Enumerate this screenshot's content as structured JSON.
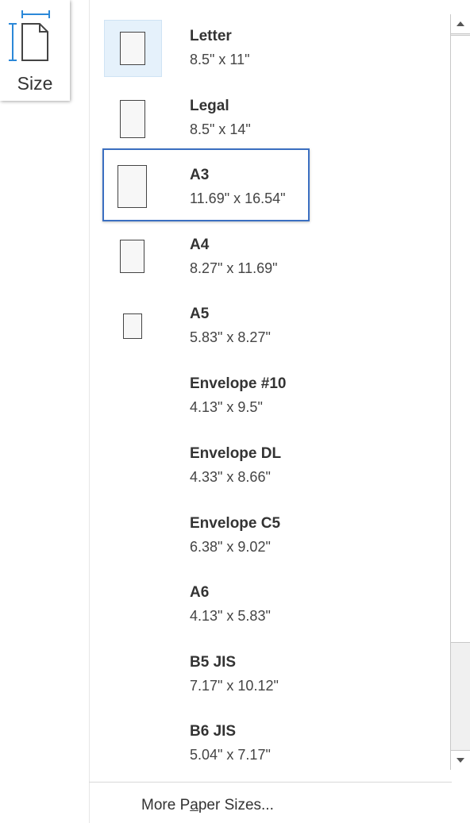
{
  "size_button": {
    "label": "Size",
    "icon": "page-size-icon"
  },
  "menu": {
    "items": [
      {
        "name": "Letter",
        "dims": "8.5\" x 11\"",
        "icon": "page-icon",
        "selected": true
      },
      {
        "name": "Legal",
        "dims": "8.5\" x 14\"",
        "icon": "page-icon"
      },
      {
        "name": "A3",
        "dims": "11.69\" x 16.54\"",
        "icon": "page-icon",
        "focused": true
      },
      {
        "name": "A4",
        "dims": "8.27\" x 11.69\"",
        "icon": "page-icon"
      },
      {
        "name": "A5",
        "dims": "5.83\" x 8.27\"",
        "icon": "page-icon"
      },
      {
        "name": "Envelope #10",
        "dims": "4.13\" x 9.5\""
      },
      {
        "name": "Envelope DL",
        "dims": "4.33\" x 8.66\""
      },
      {
        "name": "Envelope C5",
        "dims": "6.38\" x 9.02\""
      },
      {
        "name": "A6",
        "dims": "4.13\" x 5.83\""
      },
      {
        "name": "B5 JIS",
        "dims": "7.17\" x 10.12\""
      },
      {
        "name": "B6 JIS",
        "dims": "5.04\" x 7.17\""
      }
    ],
    "more_pre": "More P",
    "more_underlined": "a",
    "more_post": "per Sizes..."
  },
  "colors": {
    "selected_bg": "#e5f1fb",
    "focus_border": "#3b6fc1",
    "accent_blue": "#2b88d8"
  }
}
